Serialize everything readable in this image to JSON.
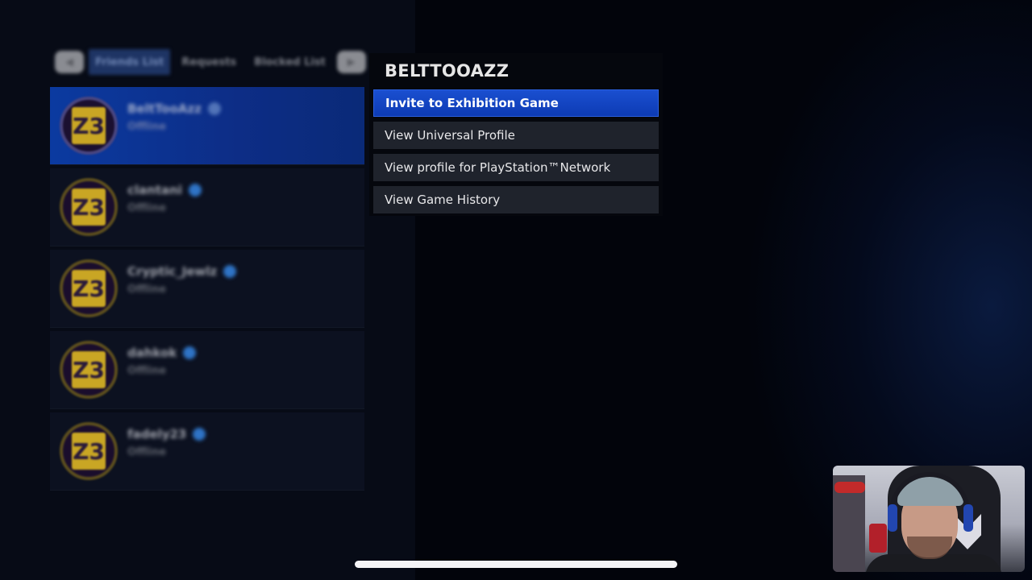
{
  "tabs": {
    "left_button_icon": "l1-bumper-icon",
    "right_button_icon": "r1-bumper-icon",
    "items": [
      {
        "label": "Friends List",
        "active": true
      },
      {
        "label": "Requests",
        "active": false
      },
      {
        "label": "Blocked List",
        "active": false
      }
    ]
  },
  "friends": [
    {
      "name": "BeltTooAzz",
      "status": "Offline",
      "avatar_text": "Z3",
      "selected": true
    },
    {
      "name": "clantani",
      "status": "Offline",
      "avatar_text": "Z3",
      "selected": false
    },
    {
      "name": "Cryptic_Jewlz",
      "status": "Offline",
      "avatar_text": "Z3",
      "selected": false
    },
    {
      "name": "dahkok",
      "status": "Offline",
      "avatar_text": "Z3",
      "selected": false
    },
    {
      "name": "fadely23",
      "status": "Offline",
      "avatar_text": "Z3",
      "selected": false
    }
  ],
  "context_menu": {
    "title": "BELTTOOAZZ",
    "items": [
      {
        "label": "Invite to Exhibition Game",
        "selected": true
      },
      {
        "label": "View Universal Profile",
        "selected": false
      },
      {
        "label": "View profile for PlayStation™Network",
        "selected": false
      },
      {
        "label": "View Game History",
        "selected": false
      }
    ]
  },
  "colors": {
    "accent_blue": "#1546c4",
    "avatar_gold": "#c9a624",
    "menu_item_bg": "#1f232c",
    "plus_badge": "#2f74c6"
  },
  "webcam": {
    "description": "streamer webcam overlay"
  }
}
